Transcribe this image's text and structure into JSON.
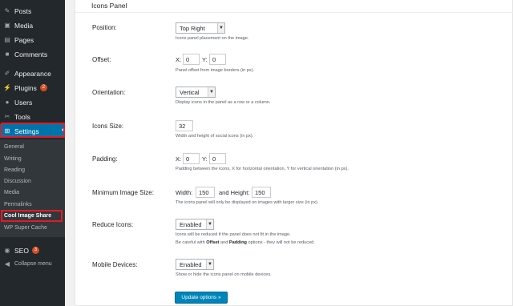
{
  "sidebar": {
    "items": [
      {
        "label": "Posts",
        "icon": "pushpin-icon"
      },
      {
        "label": "Media",
        "icon": "media-icon"
      },
      {
        "label": "Pages",
        "icon": "pages-icon"
      },
      {
        "label": "Comments",
        "icon": "comments-icon"
      },
      {
        "label": "Appearance",
        "icon": "paintbrush-icon"
      },
      {
        "label": "Plugins",
        "icon": "plugin-icon",
        "badge": "2"
      },
      {
        "label": "Users",
        "icon": "users-icon"
      },
      {
        "label": "Tools",
        "icon": "wrench-icon"
      },
      {
        "label": "Settings",
        "icon": "settings-icon"
      }
    ],
    "submenu": [
      "General",
      "Writing",
      "Reading",
      "Discussion",
      "Media",
      "Permalinks",
      "Cool Image Share",
      "WP Super Cache"
    ],
    "seo": {
      "label": "SEO",
      "badge": "3"
    },
    "collapse": "Collapse menu"
  },
  "panel": {
    "title": "Icons Panel",
    "position": {
      "label": "Position:",
      "value": "Top Right",
      "desc": "Icons panel placement on the image."
    },
    "offset": {
      "label": "Offset:",
      "x_label": "X:",
      "x": "0",
      "y_label": "Y:",
      "y": "0",
      "desc": "Panel offset from image borders (in px)."
    },
    "orientation": {
      "label": "Orientation:",
      "value": "Vertical",
      "desc": "Display icons in the panel as a row or a column."
    },
    "icons_size": {
      "label": "Icons Size:",
      "value": "32",
      "desc": "Width and height of social icons (in px)."
    },
    "padding": {
      "label": "Padding:",
      "x_label": "X:",
      "x": "0",
      "y_label": "Y:",
      "y": "0",
      "desc": "Padding between the icons, X for horizontal orientation, Y for vertical orientation (in px)."
    },
    "min_image": {
      "label": "Minimum Image Size:",
      "width_label": "Width:",
      "width": "150",
      "height_label": "and Height:",
      "height": "150",
      "desc": "The icons panel will only be displayed on images with larger size (in px)."
    },
    "reduce": {
      "label": "Reduce Icons:",
      "value": "Enabled",
      "desc1": "Icons will be reduced if the panel does not fit in the image.",
      "desc2_a": "Be careful with ",
      "desc2_b": "Offset",
      "desc2_c": " and ",
      "desc2_d": "Padding",
      "desc2_e": " options - they will not be reduced."
    },
    "mobile": {
      "label": "Mobile Devices:",
      "value": "Enabled",
      "desc": "Show or hide the icons panel on mobile devices."
    },
    "submit": "Update options »"
  },
  "colors": {
    "sidebar": "#23282d",
    "submenu": "#32373c",
    "accent": "#0073aa",
    "highlight": "#e31b23",
    "button": "#0085ba"
  }
}
